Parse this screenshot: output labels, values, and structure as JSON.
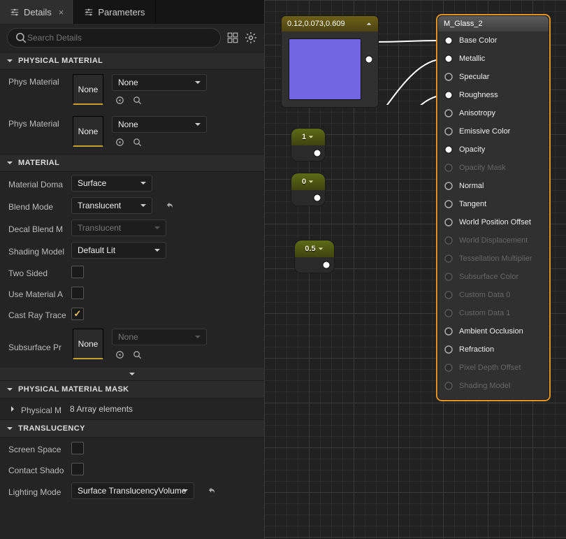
{
  "tabs": [
    {
      "label": "Details",
      "active": true
    },
    {
      "label": "Parameters",
      "active": false
    }
  ],
  "search": {
    "placeholder": "Search Details"
  },
  "sections": {
    "physMat": {
      "title": "PHYSICAL MATERIAL",
      "rows": [
        {
          "label": "Phys Material",
          "thumb": "None",
          "select": "None"
        },
        {
          "label": "Phys Material",
          "thumb": "None",
          "select": "None"
        }
      ]
    },
    "material": {
      "title": "MATERIAL",
      "domain": {
        "label": "Material Doma",
        "value": "Surface"
      },
      "blend": {
        "label": "Blend Mode",
        "value": "Translucent",
        "revert": true
      },
      "decal": {
        "label": "Decal Blend M",
        "value": "Translucent",
        "disabled": true
      },
      "shading": {
        "label": "Shading Model",
        "value": "Default Lit"
      },
      "twoSided": {
        "label": "Two Sided",
        "checked": false
      },
      "useMatAttr": {
        "label": "Use Material A",
        "checked": false
      },
      "castRay": {
        "label": "Cast Ray Trace",
        "checked": true
      },
      "subsurface": {
        "label": "Subsurface Pr",
        "thumb": "None",
        "select": "None"
      }
    },
    "physMask": {
      "title": "PHYSICAL MATERIAL MASK",
      "row": {
        "label": "Physical M",
        "value": "8 Array elements"
      }
    },
    "translucency": {
      "title": "TRANSLUCENCY",
      "screenSpace": {
        "label": "Screen Space",
        "checked": false
      },
      "contactShadow": {
        "label": "Contact Shado",
        "checked": false
      },
      "lightingMode": {
        "label": "Lighting Mode",
        "value": "Surface TranslucencyVolume",
        "revert": true
      }
    }
  },
  "graph": {
    "colorNode": {
      "label": "0.12,0.073,0.609",
      "swatch": "#7266e3"
    },
    "scalars": [
      {
        "value": "1"
      },
      {
        "value": "0"
      },
      {
        "value": "0.5"
      }
    ],
    "material": {
      "title": "M_Glass_2",
      "pins": [
        {
          "name": "Base Color",
          "enabled": true
        },
        {
          "name": "Metallic",
          "enabled": true
        },
        {
          "name": "Specular",
          "enabled": true
        },
        {
          "name": "Roughness",
          "enabled": true
        },
        {
          "name": "Anisotropy",
          "enabled": true
        },
        {
          "name": "Emissive Color",
          "enabled": true
        },
        {
          "name": "Opacity",
          "enabled": true
        },
        {
          "name": "Opacity Mask",
          "enabled": false
        },
        {
          "name": "Normal",
          "enabled": true
        },
        {
          "name": "Tangent",
          "enabled": true
        },
        {
          "name": "World Position Offset",
          "enabled": true
        },
        {
          "name": "World Displacement",
          "enabled": false
        },
        {
          "name": "Tessellation Multiplier",
          "enabled": false
        },
        {
          "name": "Subsurface Color",
          "enabled": false
        },
        {
          "name": "Custom Data 0",
          "enabled": false
        },
        {
          "name": "Custom Data 1",
          "enabled": false
        },
        {
          "name": "Ambient Occlusion",
          "enabled": true
        },
        {
          "name": "Refraction",
          "enabled": true
        },
        {
          "name": "Pixel Depth Offset",
          "enabled": false
        },
        {
          "name": "Shading Model",
          "enabled": false
        }
      ]
    }
  }
}
